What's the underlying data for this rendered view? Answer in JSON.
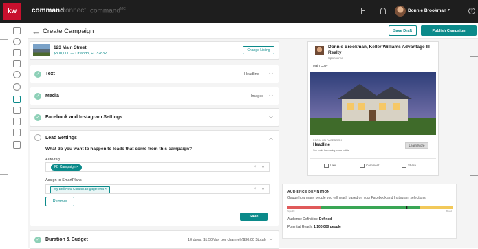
{
  "topbar": {
    "logo": "kw",
    "nav": [
      "command",
      "connect",
      "command"
    ],
    "nav_mc": "MC",
    "user_name": "Donnie Brookman",
    "caret": "▾",
    "help": "?"
  },
  "header": {
    "back": "←",
    "title": "Create Campaign",
    "save_draft": "Save Draft",
    "publish": "Publish Campaign"
  },
  "listing": {
    "address": "123 Main Street",
    "sub": "$300,000 — Orlando, FL 32832",
    "change_button": "Change Listing"
  },
  "sections": {
    "text": {
      "title": "Text",
      "right": "Headline"
    },
    "media": {
      "title": "Media",
      "right": "Images"
    },
    "fb": {
      "title": "Facebook and Instagram Settings"
    },
    "lead": {
      "title": "Lead Settings"
    },
    "duration": {
      "title": "Duration & Budget",
      "right": "10 days, $1.50/day per channel ($30.00 $total)"
    }
  },
  "lead": {
    "question": "What do you want to happen to leads that come from this campaign?",
    "autotag_label": "Auto-tag",
    "autotag_chip": "FB Campaign ×",
    "assign_label": "Assign to SmartPlans",
    "assign_chip": "My Bell New Contact Engagement ×",
    "clear": "×",
    "dropdown": "▾",
    "remove": "Remove",
    "save": "Save"
  },
  "preview": {
    "name": "Donnie Brookman, Keller Williams Advantage III Realty",
    "sponsored": "Sponsored",
    "copy": "Main Copy",
    "form_label": "FORM ON FACEBOOK",
    "headline": "Headline",
    "desc": "You could be coming home to this",
    "learn_more": "Learn More",
    "actions": [
      "Like",
      "Comment",
      "Share"
    ]
  },
  "audience": {
    "title": "AUDIENCE DEFINITION",
    "desc": "Gauge how many people you will reach based on your Facebook and Instagram selections.",
    "specific": "Specific",
    "broad": "Broad",
    "definition_label": "Audience Definition:",
    "definition_value": "Defined",
    "reach_label": "Potential Reach:",
    "reach_value": "1,100,000 people",
    "marker_position": 0.72
  },
  "colors": {
    "accent": "#0b8a8a",
    "brand_red": "#c8102e",
    "check": "#8dd0b7",
    "bar_red": "#e05a5a",
    "bar_green": "#3aa655",
    "bar_yellow": "#f2c95a"
  }
}
